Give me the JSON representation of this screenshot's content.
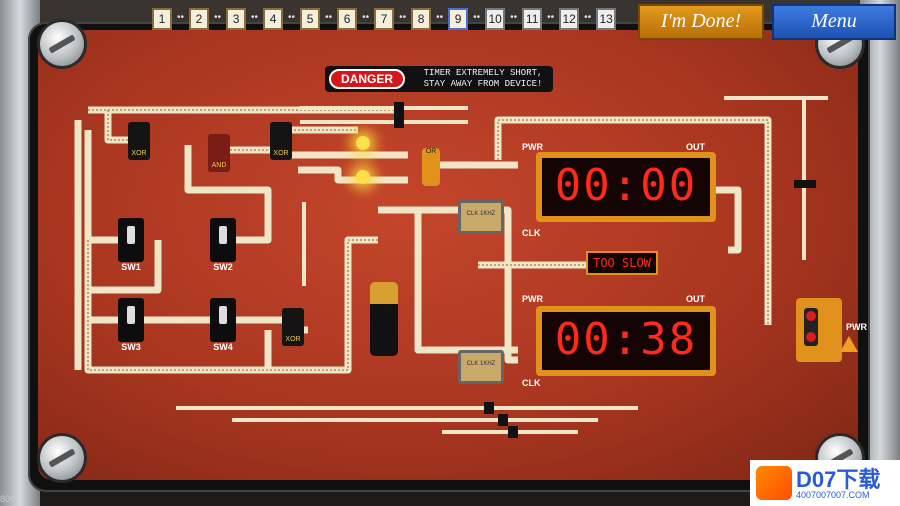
{
  "levels": {
    "items": [
      "1",
      "2",
      "3",
      "4",
      "5",
      "6",
      "7",
      "8",
      "9",
      "10",
      "11",
      "12",
      "13"
    ],
    "current": "9",
    "unlocked_upto": 9
  },
  "buttons": {
    "done_label": "I'm Done!",
    "menu_label": "Menu"
  },
  "danger": {
    "badge": "DANGER",
    "line1": "TIMER EXTREMELY SHORT,",
    "line2": "STAY AWAY FROM DEVICE!"
  },
  "timers": {
    "top": {
      "display": "00:00",
      "pwr_label": "PWR",
      "out_label": "OUT",
      "clk_label": "CLK"
    },
    "bottom": {
      "display": "00:38",
      "pwr_label": "PWR",
      "out_label": "OUT",
      "clk_label": "CLK"
    },
    "status": "TOO SLOW"
  },
  "gates": {
    "xor": "XOR",
    "and": "AND",
    "or": "OR",
    "clk": "CLK 1KHZ"
  },
  "switches": [
    "SW1",
    "SW2",
    "SW3",
    "SW4"
  ],
  "power": {
    "label": "PWR"
  },
  "watermark": {
    "main": "D07下载",
    "sub": "4007007007.COM"
  },
  "corner_text": "806",
  "colors": {
    "pcb": "#b23a22",
    "timer_frame": "#e0921c",
    "digits": "#ff2a1a",
    "menu": "#2e66cc",
    "done": "#d08514"
  }
}
